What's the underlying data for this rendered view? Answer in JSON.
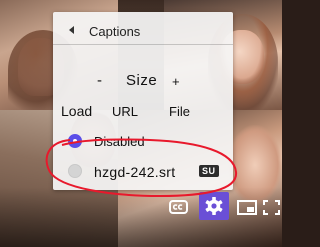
{
  "menu": {
    "header": {
      "title": "Captions",
      "back_icon": "chevron-left-icon"
    },
    "size": {
      "minus": "-",
      "label": "Size",
      "plus": "+"
    },
    "load": {
      "label": "Load",
      "url": "URL",
      "file": "File"
    },
    "options": [
      {
        "label": "Disabled",
        "selected": true
      },
      {
        "label": "hzgd-242.srt",
        "selected": false,
        "badge": "SU"
      }
    ]
  },
  "controls": {
    "icons": [
      "captions-icon",
      "settings-icon",
      "picture-in-picture-icon",
      "fullscreen-icon"
    ],
    "accent": "#6a4fd6"
  },
  "annotation": {
    "color": "#e8192c"
  }
}
